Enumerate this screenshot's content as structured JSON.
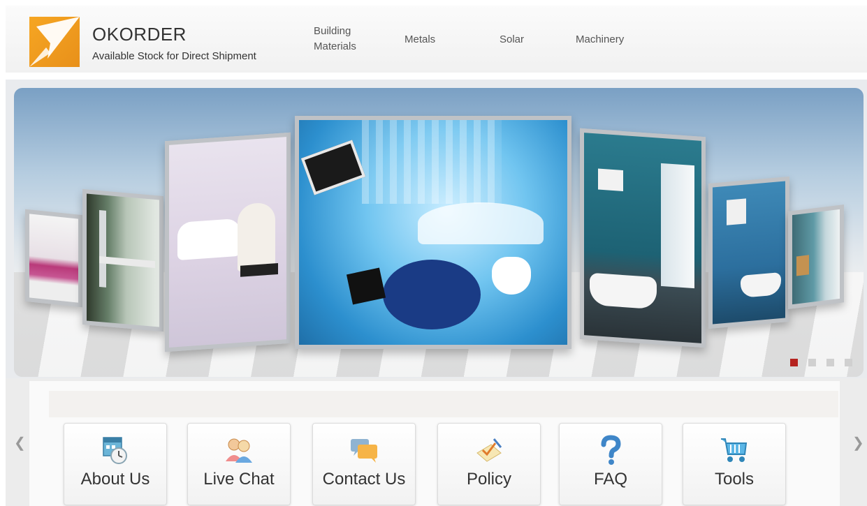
{
  "header": {
    "brand": "OKORDER",
    "tagline": "Available Stock for Direct Shipment",
    "logo_icon": "okorder-logo-icon",
    "nav": [
      {
        "line1": "Building",
        "line2": "Materials"
      },
      {
        "line1": "Metals",
        "line2": ""
      },
      {
        "line1": "Solar",
        "line2": ""
      },
      {
        "line1": "Machinery",
        "line2": ""
      }
    ]
  },
  "banner": {
    "slides_count": 4,
    "active_slide": 1,
    "active_color": "#b5231f",
    "inactive_color": "#d0d0d0"
  },
  "quicklinks": {
    "prev_arrow": "❮",
    "next_arrow": "❯",
    "items": [
      {
        "label": "About Us",
        "icon": "calendar-clock-icon"
      },
      {
        "label": "Live Chat",
        "icon": "people-chat-icon"
      },
      {
        "label": "Contact Us",
        "icon": "speech-bubbles-icon"
      },
      {
        "label": "Policy",
        "icon": "checklist-icon"
      },
      {
        "label": "FAQ",
        "icon": "question-mark-icon"
      },
      {
        "label": "Tools",
        "icon": "shopping-cart-icon"
      }
    ]
  }
}
